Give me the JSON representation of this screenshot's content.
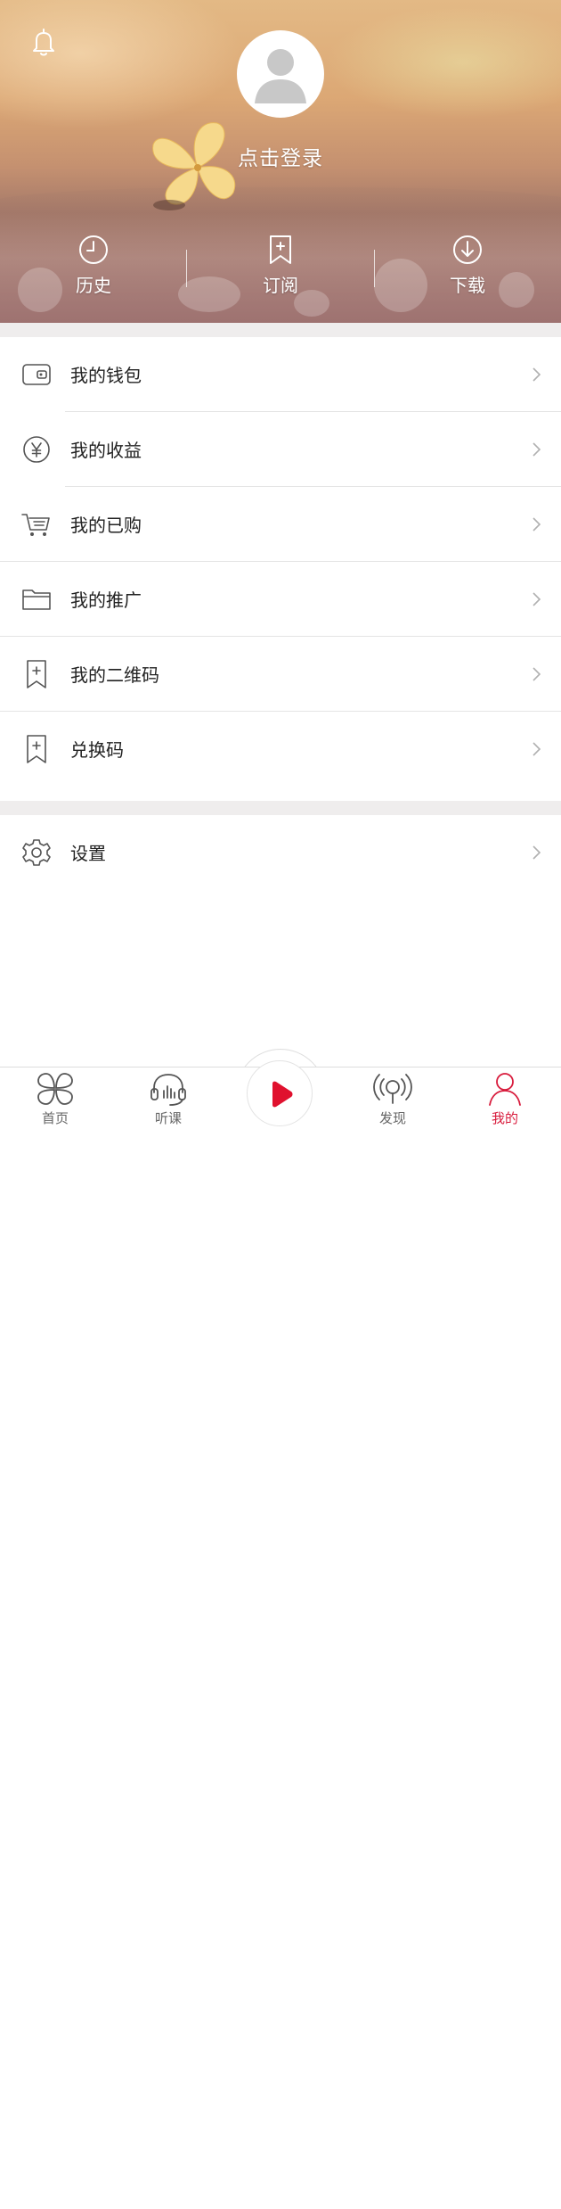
{
  "header": {
    "login_text": "点击登录",
    "quick_links": [
      {
        "label": "历史",
        "icon": "clock-icon"
      },
      {
        "label": "订阅",
        "icon": "bookmark-plus-icon"
      },
      {
        "label": "下载",
        "icon": "download-icon"
      }
    ]
  },
  "menu": {
    "group1": [
      {
        "label": "我的钱包",
        "icon": "wallet-icon"
      },
      {
        "label": "我的收益",
        "icon": "yen-icon"
      },
      {
        "label": "我的已购",
        "icon": "cart-icon"
      },
      {
        "label": "我的推广",
        "icon": "folder-icon"
      },
      {
        "label": "我的二维码",
        "icon": "bookmark-plus-icon"
      },
      {
        "label": "兑换码",
        "icon": "bookmark-plus-icon"
      }
    ],
    "group2": [
      {
        "label": "设置",
        "icon": "gear-icon"
      }
    ]
  },
  "nav": {
    "items": [
      {
        "label": "首页",
        "icon": "clover-icon"
      },
      {
        "label": "听课",
        "icon": "headphones-icon"
      },
      {
        "label": "发现",
        "icon": "broadcast-icon"
      },
      {
        "label": "我的",
        "icon": "person-icon",
        "active": true
      }
    ],
    "active_color": "#d81b3c",
    "play_color": "#e0112e"
  }
}
